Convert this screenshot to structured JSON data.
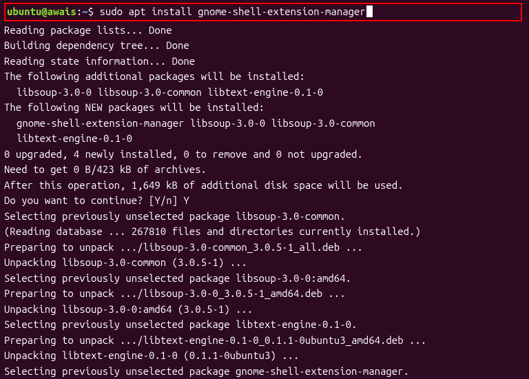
{
  "prompt": {
    "user_host": "ubuntu@awais",
    "colon": ":",
    "tilde": "~",
    "dollar": "$ ",
    "command": "sudo apt install gnome-shell-extension-manager"
  },
  "lines": [
    {
      "text": "Reading package lists... Done",
      "indent": false
    },
    {
      "text": "Building dependency tree... Done",
      "indent": false
    },
    {
      "text": "Reading state information... Done",
      "indent": false
    },
    {
      "text": "The following additional packages will be installed:",
      "indent": false
    },
    {
      "text": "libsoup-3.0-0 libsoup-3.0-common libtext-engine-0.1-0",
      "indent": true
    },
    {
      "text": "The following NEW packages will be installed:",
      "indent": false
    },
    {
      "text": "gnome-shell-extension-manager libsoup-3.0-0 libsoup-3.0-common",
      "indent": true
    },
    {
      "text": "libtext-engine-0.1-0",
      "indent": true
    },
    {
      "text": "0 upgraded, 4 newly installed, 0 to remove and 0 not upgraded.",
      "indent": false
    },
    {
      "text": "Need to get 0 B/423 kB of archives.",
      "indent": false
    },
    {
      "text": "After this operation, 1,649 kB of additional disk space will be used.",
      "indent": false
    },
    {
      "text": "Do you want to continue? [Y/n] Y",
      "indent": false
    },
    {
      "text": "Selecting previously unselected package libsoup-3.0-common.",
      "indent": false
    },
    {
      "text": "(Reading database ... 267810 files and directories currently installed.)",
      "indent": false
    },
    {
      "text": "Preparing to unpack .../libsoup-3.0-common_3.0.5-1_all.deb ...",
      "indent": false
    },
    {
      "text": "Unpacking libsoup-3.0-common (3.0.5-1) ...",
      "indent": false
    },
    {
      "text": "Selecting previously unselected package libsoup-3.0-0:amd64.",
      "indent": false
    },
    {
      "text": "Preparing to unpack .../libsoup-3.0-0_3.0.5-1_amd64.deb ...",
      "indent": false
    },
    {
      "text": "Unpacking libsoup-3.0-0:amd64 (3.0.5-1) ...",
      "indent": false
    },
    {
      "text": "Selecting previously unselected package libtext-engine-0.1-0.",
      "indent": false
    },
    {
      "text": "Preparing to unpack .../libtext-engine-0.1-0_0.1.1-0ubuntu3_amd64.deb ...",
      "indent": false
    },
    {
      "text": "Unpacking libtext-engine-0.1-0 (0.1.1-0ubuntu3) ...",
      "indent": false
    },
    {
      "text": "Selecting previously unselected package gnome-shell-extension-manager.",
      "indent": false
    }
  ]
}
